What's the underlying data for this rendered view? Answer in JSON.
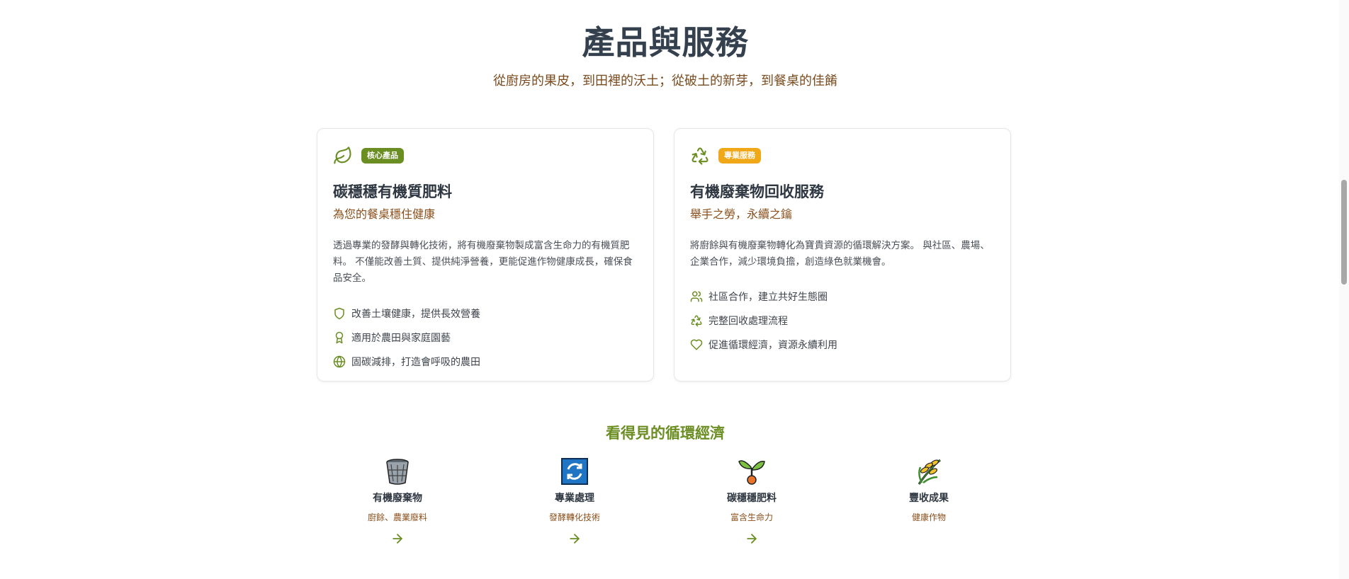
{
  "header": {
    "title": "產品與服務",
    "subtitle": "從廚房的果皮，到田裡的沃土；從破土的新芽，到餐桌的佳餚"
  },
  "cards": [
    {
      "icon": "leaf-icon",
      "badge": "核心產品",
      "badge_color": "#6b8e23",
      "title": "碳穩穩有機質肥料",
      "subtitle": "為您的餐桌穩住健康",
      "description": "透過專業的發酵與轉化技術，將有機廢棄物製成富含生命力的有機質肥料。 不僅能改善土質、提供純淨營養，更能促進作物健康成長，確保食品安全。",
      "features": [
        {
          "icon": "shield-icon",
          "text": "改善土壤健康，提供長效營養"
        },
        {
          "icon": "award-icon",
          "text": "適用於農田與家庭園藝"
        },
        {
          "icon": "globe-icon",
          "text": "固碳減排，打造會呼吸的農田"
        }
      ]
    },
    {
      "icon": "recycle-icon",
      "badge": "專業服務",
      "badge_color": "#f0a818",
      "title": "有機廢棄物回收服務",
      "subtitle": "舉手之勞，永續之鑰",
      "description": "將廚餘與有機廢棄物轉化為寶貴資源的循環解決方案。 與社區、農場、企業合作，減少環境負擔，創造綠色就業機會。",
      "features": [
        {
          "icon": "users-icon",
          "text": "社區合作，建立共好生態圈"
        },
        {
          "icon": "recycle-icon",
          "text": "完整回收處理流程"
        },
        {
          "icon": "heart-icon",
          "text": "促進循環經濟，資源永續利用"
        }
      ]
    }
  ],
  "circular": {
    "title": "看得見的循環經濟",
    "steps": [
      {
        "icon": "wastebasket-icon",
        "name": "有機廢棄物",
        "desc": "廚餘、農業廢料"
      },
      {
        "icon": "arrows-cycle-icon",
        "name": "專業處理",
        "desc": "發酵轉化技術"
      },
      {
        "icon": "seedling-icon",
        "name": "碳穩穩肥料",
        "desc": "富含生命力"
      },
      {
        "icon": "rice-icon",
        "name": "豐收成果",
        "desc": "健康作物"
      }
    ]
  },
  "colors": {
    "accent_green": "#6b8e23",
    "accent_orange": "#f0a818",
    "brown_text": "#8a4e1a",
    "heading": "#34404d"
  }
}
